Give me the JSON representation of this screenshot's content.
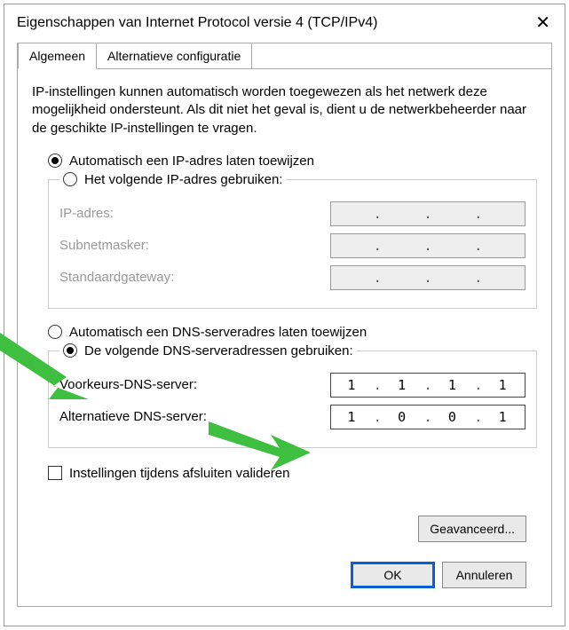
{
  "dialog": {
    "title": "Eigenschappen van Internet Protocol versie 4 (TCP/IPv4)"
  },
  "tabs": {
    "general": "Algemeen",
    "alternate": "Alternatieve configuratie"
  },
  "intro": "IP-instellingen kunnen automatisch worden toegewezen als het netwerk deze mogelijkheid ondersteunt. Als dit niet het geval is, dient u de netwerkbeheerder naar de geschikte IP-instellingen te vragen.",
  "ip_section": {
    "auto_label": "Automatisch een IP-adres laten toewijzen",
    "manual_label": "Het volgende IP-adres gebruiken:",
    "selected": "auto",
    "fields": {
      "ip": "IP-adres:",
      "subnet": "Subnetmasker:",
      "gateway": "Standaardgateway:"
    },
    "values": {
      "ip": [
        "",
        "",
        "",
        ""
      ],
      "subnet": [
        "",
        "",
        "",
        ""
      ],
      "gateway": [
        "",
        "",
        "",
        ""
      ]
    }
  },
  "dns_section": {
    "auto_label": "Automatisch een DNS-serveradres laten toewijzen",
    "manual_label": "De volgende DNS-serveradressen gebruiken:",
    "selected": "manual",
    "fields": {
      "preferred": "Voorkeurs-DNS-server:",
      "alternate": "Alternatieve DNS-server:"
    },
    "values": {
      "preferred": [
        "1",
        "1",
        "1",
        "1"
      ],
      "alternate": [
        "1",
        "0",
        "0",
        "1"
      ]
    }
  },
  "validate_checkbox": {
    "label": "Instellingen tijdens afsluiten valideren",
    "checked": false
  },
  "buttons": {
    "advanced": "Geavanceerd...",
    "ok": "OK",
    "cancel": "Annuleren"
  }
}
